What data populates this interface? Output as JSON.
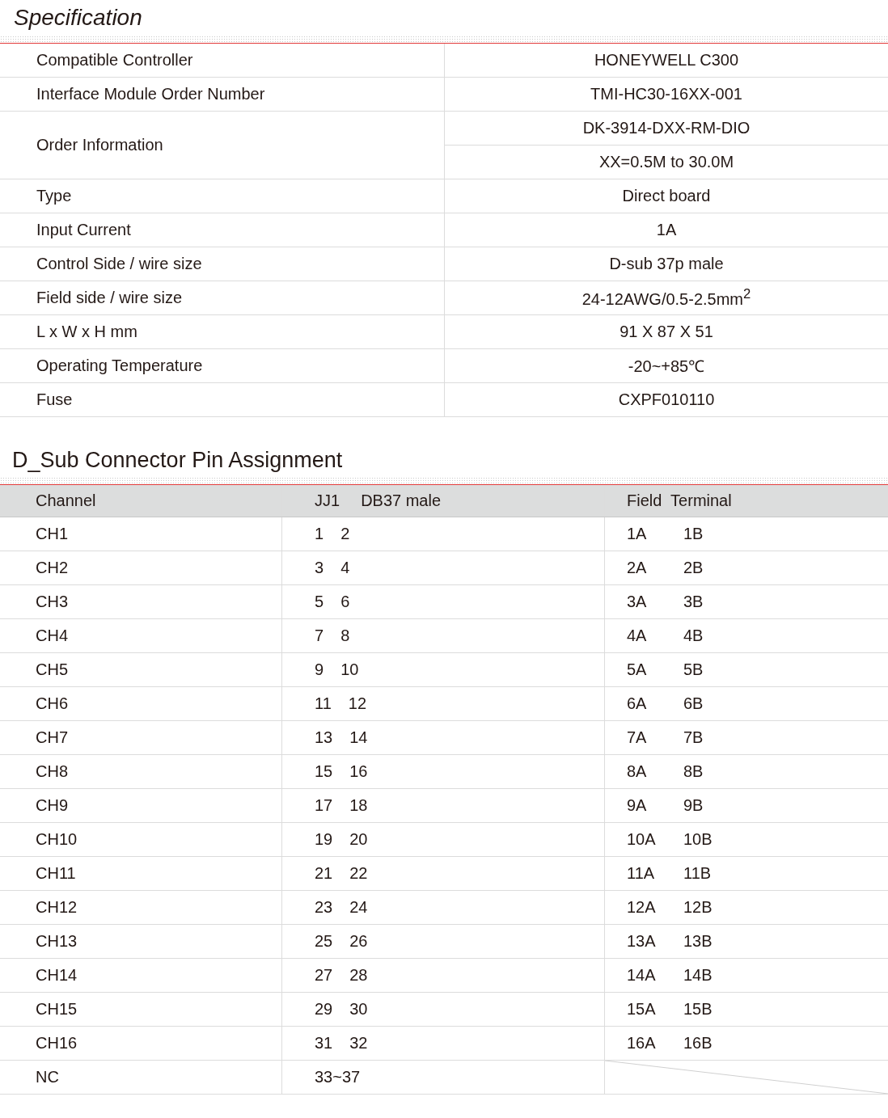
{
  "specification": {
    "title": "Specification",
    "rows": [
      {
        "label": "Compatible Controller",
        "values": [
          "HONEYWELL C300"
        ]
      },
      {
        "label": "Interface Module Order Number",
        "values": [
          "TMI-HC30-16XX-001"
        ]
      },
      {
        "label": "Order Information",
        "values": [
          "DK-3914-DXX-RM-DIO",
          "XX=0.5M to 30.0M"
        ]
      },
      {
        "label": "Type",
        "values": [
          "Direct board"
        ]
      },
      {
        "label": "Input Current",
        "values": [
          "1A"
        ]
      },
      {
        "label": "Control Side / wire size",
        "values": [
          "D-sub 37p male"
        ]
      },
      {
        "label": "Field side / wire size",
        "values": [
          "24-12AWG/0.5-2.5mm$^{2}$"
        ]
      },
      {
        "label": "L x W x H mm",
        "values": [
          "91 X 87 X 51"
        ]
      },
      {
        "label": "Operating Temperature",
        "values": [
          "-20~+85℃"
        ]
      },
      {
        "label": "Fuse",
        "values": [
          "CXPF010110"
        ]
      }
    ]
  },
  "pin_assignment": {
    "title": "D_Sub Connector Pin Assignment",
    "columns": [
      [
        "Channel"
      ],
      [
        "JJ1",
        "DB37 male"
      ],
      [
        "Field  Terminal"
      ]
    ],
    "rows": [
      {
        "channel": "CH1",
        "pins": [
          "1",
          "2"
        ],
        "terminals": [
          "1A",
          "1B"
        ]
      },
      {
        "channel": "CH2",
        "pins": [
          "3",
          "4"
        ],
        "terminals": [
          "2A",
          "2B"
        ]
      },
      {
        "channel": "CH3",
        "pins": [
          "5",
          "6"
        ],
        "terminals": [
          "3A",
          "3B"
        ]
      },
      {
        "channel": "CH4",
        "pins": [
          "7",
          "8"
        ],
        "terminals": [
          "4A",
          "4B"
        ]
      },
      {
        "channel": "CH5",
        "pins": [
          "9",
          "10"
        ],
        "terminals": [
          "5A",
          "5B"
        ]
      },
      {
        "channel": "CH6",
        "pins": [
          "11",
          "12"
        ],
        "terminals": [
          "6A",
          "6B"
        ]
      },
      {
        "channel": "CH7",
        "pins": [
          "13",
          "14"
        ],
        "terminals": [
          "7A",
          "7B"
        ]
      },
      {
        "channel": "CH8",
        "pins": [
          "15",
          "16"
        ],
        "terminals": [
          "8A",
          "8B"
        ]
      },
      {
        "channel": "CH9",
        "pins": [
          "17",
          "18"
        ],
        "terminals": [
          "9A",
          "9B"
        ]
      },
      {
        "channel": "CH10",
        "pins": [
          "19",
          "20"
        ],
        "terminals": [
          "10A",
          "10B"
        ]
      },
      {
        "channel": "CH11",
        "pins": [
          "21",
          "22"
        ],
        "terminals": [
          "11A",
          "11B"
        ]
      },
      {
        "channel": "CH12",
        "pins": [
          "23",
          "24"
        ],
        "terminals": [
          "12A",
          "12B"
        ]
      },
      {
        "channel": "CH13",
        "pins": [
          "25",
          "26"
        ],
        "terminals": [
          "13A",
          "13B"
        ]
      },
      {
        "channel": "CH14",
        "pins": [
          "27",
          "28"
        ],
        "terminals": [
          "14A",
          "14B"
        ]
      },
      {
        "channel": "CH15",
        "pins": [
          "29",
          "30"
        ],
        "terminals": [
          "15A",
          "15B"
        ]
      },
      {
        "channel": "CH16",
        "pins": [
          "31",
          "32"
        ],
        "terminals": [
          "16A",
          "16B"
        ]
      },
      {
        "channel": "NC",
        "pins": [
          "33~37"
        ]
      }
    ]
  }
}
